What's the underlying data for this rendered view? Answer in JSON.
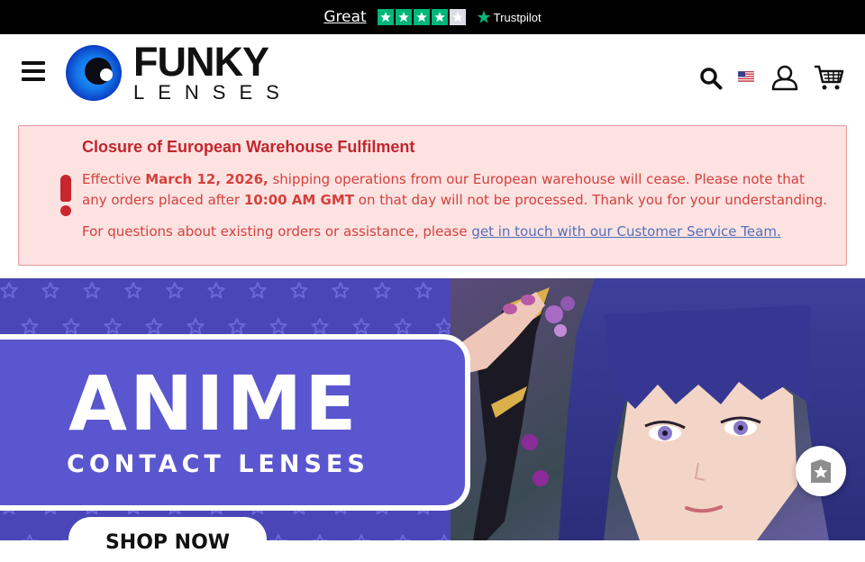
{
  "trustpilot": {
    "rating_label": "Great",
    "stars_filled": 4,
    "stars_total": 5,
    "brand": "Trustpilot",
    "color_green": "#00b67a"
  },
  "header": {
    "logo_word1": "FUNKY",
    "logo_word2": "LENSES",
    "icons": [
      "menu-icon",
      "search-icon",
      "us-flag-icon",
      "user-icon",
      "cart-icon"
    ]
  },
  "notice": {
    "title": "Closure of European Warehouse Fulfilment",
    "text_1": "Effective ",
    "date": "March 12, 2026,",
    "text_2": " shipping operations from our European warehouse will cease. Please note that any orders placed after ",
    "time": "10:00 AM GMT",
    "text_3": " on that day will not be processed. Thank you for your understanding.",
    "contact_text": "For questions about existing orders or assistance, please ",
    "contact_link": "get in touch with our Customer Service Team.",
    "colors": {
      "background": "#fde2e2",
      "border": "#e39b9b",
      "accent": "#c0262d",
      "link": "#5470b8"
    }
  },
  "hero": {
    "title": "ANIME",
    "subtitle": "CONTACT LENSES",
    "button_label": "SHOP NOW",
    "background_color": "#4a46b8"
  },
  "floating": {
    "icon": "rewards-badge-icon"
  }
}
